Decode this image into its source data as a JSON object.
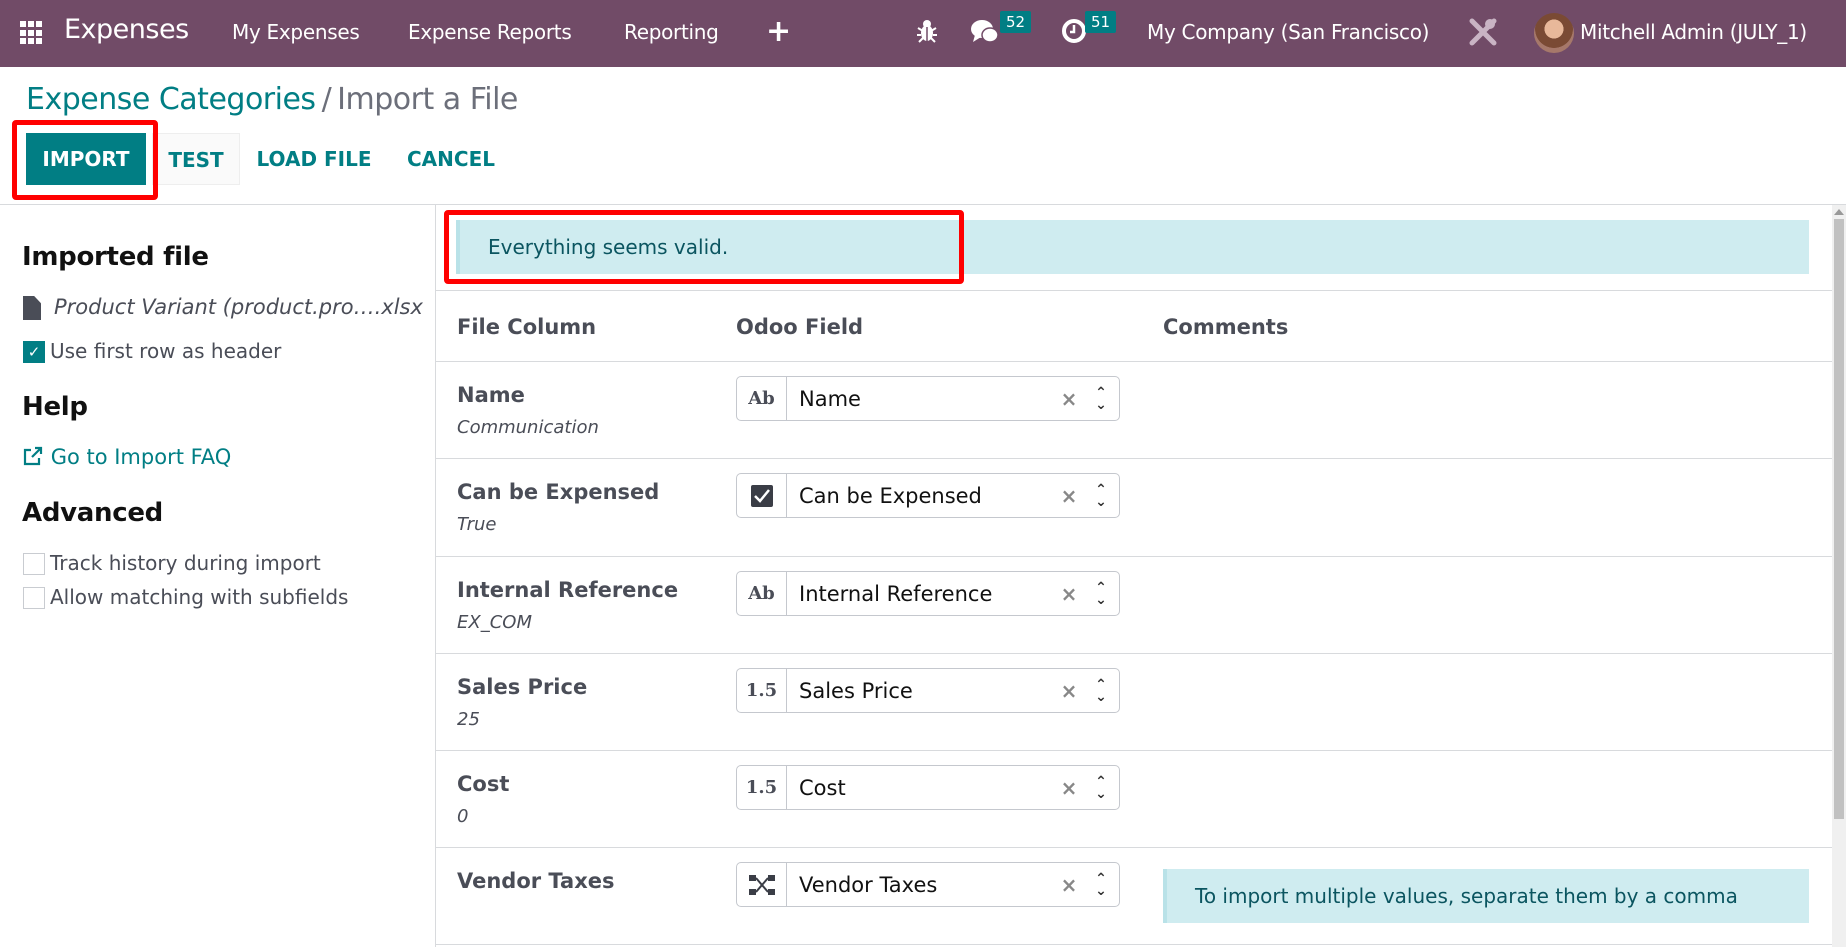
{
  "navbar": {
    "app_name": "Expenses",
    "menu": [
      "My Expenses",
      "Expense Reports",
      "Reporting"
    ],
    "plus_icon": "plus-icon",
    "debug_icon": "bug-icon",
    "messages_icon": "chat-icon",
    "messages_count": "52",
    "activities_icon": "clock-icon",
    "activities_count": "51",
    "company": "My Company (San Francisco)",
    "settings_icon": "tools-icon",
    "user": "Mitchell Admin (JULY_1)",
    "color": "#714B67"
  },
  "breadcrumb": {
    "parent": "Expense Categories",
    "separator": "/",
    "current": "Import a File"
  },
  "toolbar": {
    "import_label": "IMPORT",
    "test_label": "TEST",
    "load_file_label": "LOAD FILE",
    "cancel_label": "CANCEL",
    "accent_color": "#017E84"
  },
  "sidebar": {
    "imported_file_heading": "Imported file",
    "file_name": "Product Variant (product.pro….xlsx",
    "use_first_row_label": "Use first row as header",
    "use_first_row_checked": true,
    "help_heading": "Help",
    "faq_link": "Go to Import FAQ",
    "advanced_heading": "Advanced",
    "track_history_label": "Track history during import",
    "track_history_checked": false,
    "allow_matching_label": "Allow matching with subfields",
    "allow_matching_checked": false
  },
  "main": {
    "status_message": "Everything seems valid.",
    "columns": [
      "File Column",
      "Odoo Field",
      "Comments"
    ],
    "rows": [
      {
        "file_column": "Name",
        "sample": "Communication",
        "field_type": "Ab",
        "field_type_icon": "text-type-icon",
        "odoo_field": "Name",
        "comment": ""
      },
      {
        "file_column": "Can be Expensed",
        "sample": "True",
        "field_type": "☑",
        "field_type_icon": "boolean-type-icon",
        "odoo_field": "Can be Expensed",
        "comment": ""
      },
      {
        "file_column": "Internal Reference",
        "sample": "EX_COM",
        "field_type": "Ab",
        "field_type_icon": "text-type-icon",
        "odoo_field": "Internal Reference",
        "comment": ""
      },
      {
        "file_column": "Sales Price",
        "sample": "25",
        "field_type": "1.5",
        "field_type_icon": "float-type-icon",
        "odoo_field": "Sales Price",
        "comment": ""
      },
      {
        "file_column": "Cost",
        "sample": "0",
        "field_type": "1.5",
        "field_type_icon": "float-type-icon",
        "odoo_field": "Cost",
        "comment": ""
      },
      {
        "file_column": "Vendor Taxes",
        "sample": "",
        "field_type": "",
        "field_type_icon": "many2many-type-icon",
        "odoo_field": "Vendor Taxes",
        "comment": "To import multiple values, separate them by a comma"
      }
    ],
    "clear_glyph": "×"
  }
}
